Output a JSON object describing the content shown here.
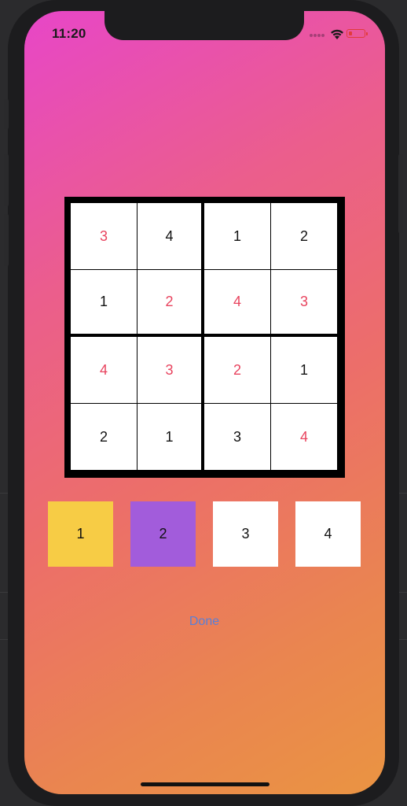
{
  "status_bar": {
    "time": "11:20",
    "icons": [
      "cellular-signal-icon",
      "wifi-icon",
      "battery-icon"
    ],
    "battery_color": "#e23b3b"
  },
  "board": {
    "rows": [
      [
        {
          "value": "3",
          "type": "entered"
        },
        {
          "value": "4",
          "type": "given"
        },
        {
          "value": "1",
          "type": "given"
        },
        {
          "value": "2",
          "type": "given"
        }
      ],
      [
        {
          "value": "1",
          "type": "given"
        },
        {
          "value": "2",
          "type": "entered"
        },
        {
          "value": "4",
          "type": "entered"
        },
        {
          "value": "3",
          "type": "entered"
        }
      ],
      [
        {
          "value": "4",
          "type": "entered"
        },
        {
          "value": "3",
          "type": "entered"
        },
        {
          "value": "2",
          "type": "entered"
        },
        {
          "value": "1",
          "type": "given"
        }
      ],
      [
        {
          "value": "2",
          "type": "given"
        },
        {
          "value": "1",
          "type": "given"
        },
        {
          "value": "3",
          "type": "given"
        },
        {
          "value": "4",
          "type": "entered"
        }
      ]
    ],
    "given_color": "#111111",
    "entered_color": "#e8435e"
  },
  "choices": [
    {
      "label": "1",
      "color": "#f7cc45"
    },
    {
      "label": "2",
      "color": "#a25cdb"
    },
    {
      "label": "3",
      "color": "#ffffff"
    },
    {
      "label": "4",
      "color": "#ffffff"
    }
  ],
  "done_label": "Done",
  "colors": {
    "gradient_start": "#e746c8",
    "gradient_end": "#ea9442",
    "done_text": "#5a7fd6"
  }
}
